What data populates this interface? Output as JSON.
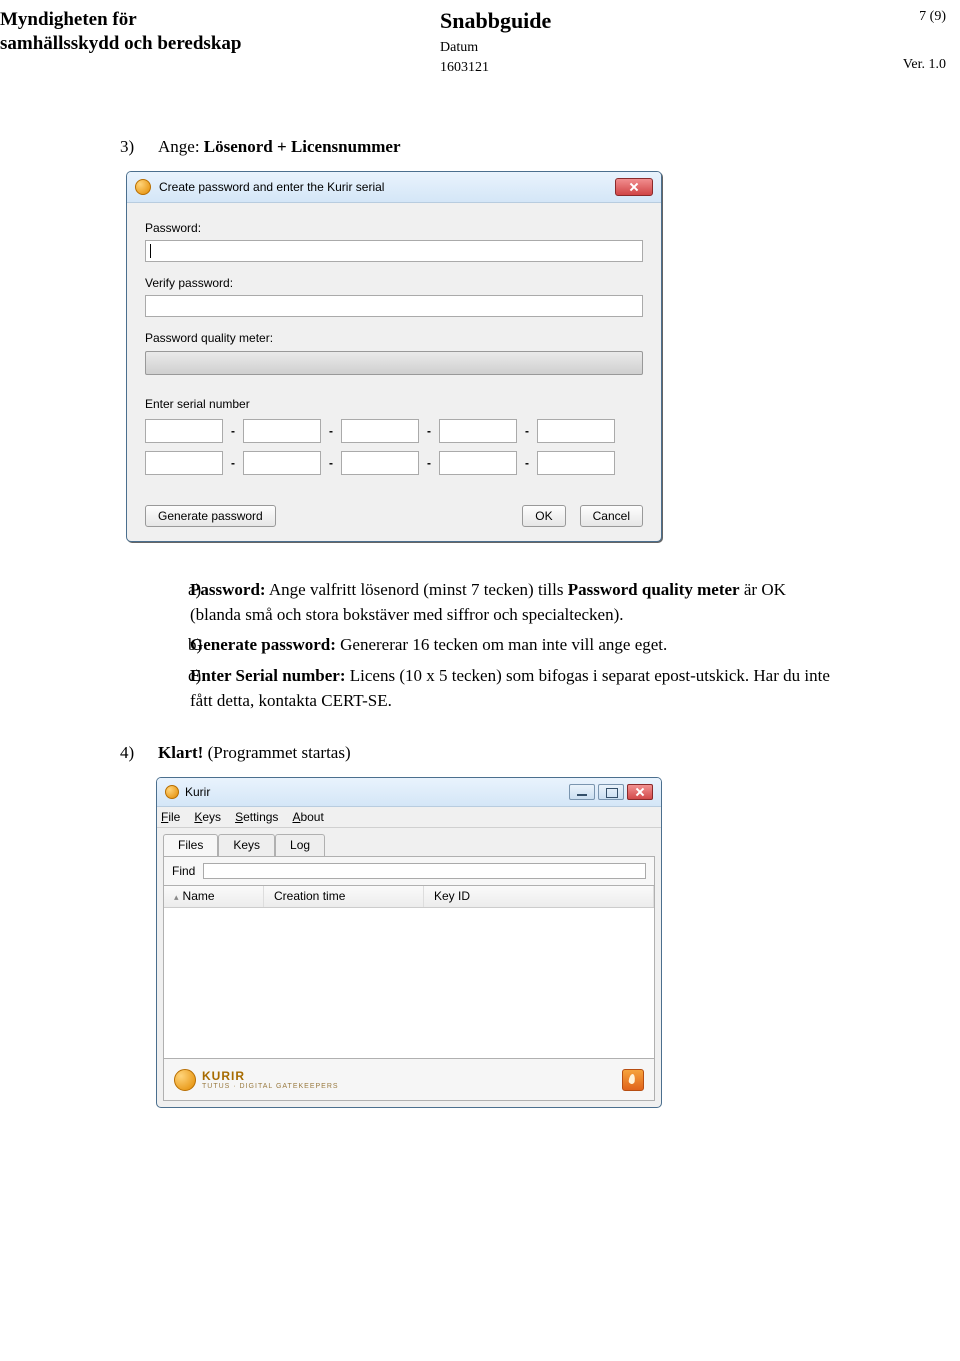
{
  "header": {
    "org_line1": "Myndigheten för",
    "org_line2": "samhällsskydd och beredskap",
    "title": "Snabbguide",
    "datum_label": "Datum",
    "datum_value": "1603121",
    "page": "7 (9)",
    "version": "Ver. 1.0"
  },
  "step3": {
    "num": "3)",
    "text_prefix": "Ange: ",
    "text_bold": "Lösenord + Licensnummer"
  },
  "dialog1": {
    "title": "Create password and enter the Kurir serial",
    "password_label": "Password:",
    "verify_label": "Verify password:",
    "quality_label": "Password quality meter:",
    "serial_label": "Enter serial number",
    "generate_btn": "Generate password",
    "ok_btn": "OK",
    "cancel_btn": "Cancel"
  },
  "substeps": {
    "a": {
      "let": "a)",
      "l1_b": "Password:",
      "l1_r": " Ange valfritt lösenord (minst 7 tecken) tills ",
      "l2_b": "Password quality meter",
      "l2_r": " är OK (blanda små och stora bokstäver med siffror och specialtecken)."
    },
    "b": {
      "let": "b)",
      "l1_b": "Generate password:",
      "l1_r": " Genererar 16 tecken om man inte vill ange eget."
    },
    "c": {
      "let": "c)",
      "l1_b": "Enter Serial number:",
      "l1_r": " Licens (10 x 5 tecken) som bifogas i separat epost-utskick. Har du inte fått detta, kontakta CERT-SE."
    }
  },
  "step4": {
    "num": "4)",
    "text_bold": "Klart!",
    "text_rest": " (Programmet startas)"
  },
  "dialog2": {
    "title": "Kurir",
    "menu": {
      "file": "File",
      "keys": "Keys",
      "settings": "Settings",
      "about": "About"
    },
    "tabs": {
      "files": "Files",
      "keys": "Keys",
      "log": "Log"
    },
    "find_label": "Find",
    "cols": {
      "name": "Name",
      "ctime": "Creation time",
      "keyid": "Key ID"
    },
    "logo": "KURIR",
    "logo_sub": "TUTUS · DIGITAL GATEKEEPERS"
  }
}
